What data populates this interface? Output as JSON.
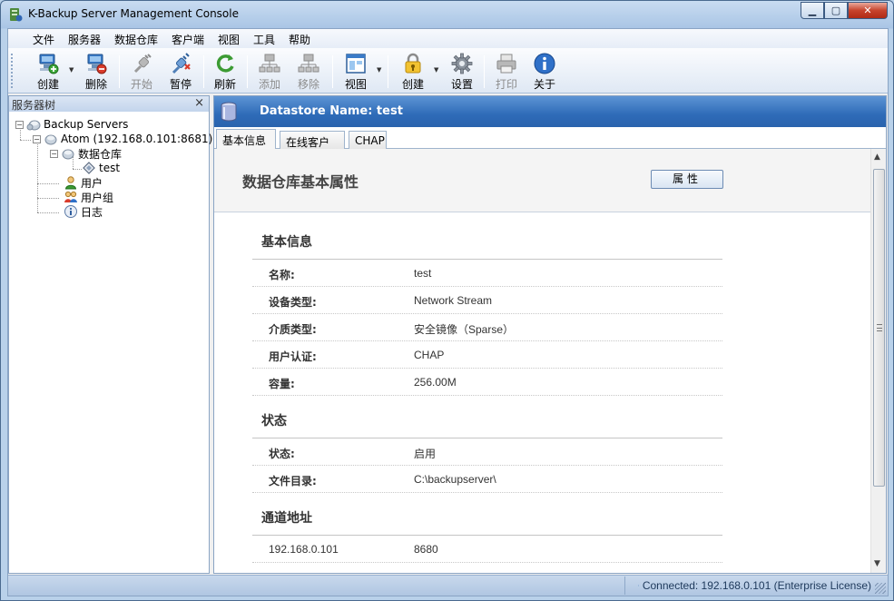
{
  "window": {
    "title": "K-Backup Server Management Console"
  },
  "menu": [
    "文件",
    "服务器",
    "数据仓库",
    "客户端",
    "视图",
    "工具",
    "帮助"
  ],
  "toolbar": {
    "create": "创建",
    "delete": "删除",
    "start": "开始",
    "pause": "暂停",
    "refresh": "刷新",
    "add": "添加",
    "remove": "移除",
    "view": "视图",
    "create_lock": "创建",
    "settings": "设置",
    "print": "打印",
    "about": "关于"
  },
  "tree": {
    "panel_title": "服务器树",
    "close": "×",
    "root": "Backup Servers",
    "server": "Atom (192.168.0.101:8681)",
    "datastores": "数据仓库",
    "datastore_item": "test",
    "users": "用户",
    "groups": "用户组",
    "logs": "日志"
  },
  "datastore": {
    "header": "Datastore Name: test",
    "tabs": [
      "基本信息",
      "在线客户端",
      "CHAP"
    ],
    "page_title": "数据仓库基本属性",
    "properties_button": "属性",
    "sections": {
      "basic": {
        "title": "基本信息",
        "rows": [
          {
            "label": "名称:",
            "value": "test"
          },
          {
            "label": "设备类型:",
            "value": "Network Stream"
          },
          {
            "label": "介质类型:",
            "value": "安全镜像（Sparse）"
          },
          {
            "label": "用户认证:",
            "value": "CHAP"
          },
          {
            "label": "容量:",
            "value": "256.00M"
          }
        ]
      },
      "status": {
        "title": "状态",
        "rows": [
          {
            "label": "状态:",
            "value": "启用"
          },
          {
            "label": "文件目录:",
            "value": "C:\\backupserver\\"
          }
        ]
      },
      "channel": {
        "title": "通道地址",
        "rows": [
          {
            "address": "192.168.0.101",
            "port": "8680"
          }
        ]
      }
    }
  },
  "status": {
    "text": "Connected: 192.168.0.101 (Enterprise License)"
  }
}
